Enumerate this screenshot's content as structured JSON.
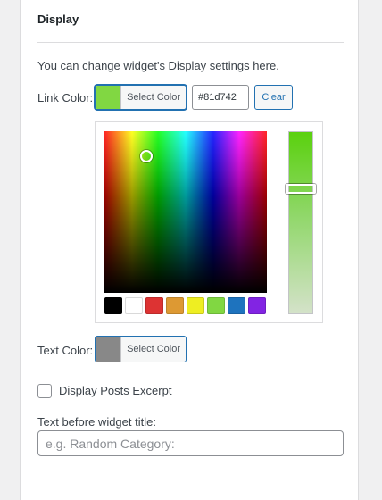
{
  "section": {
    "heading": "Display",
    "description": "You can change widget's Display settings here."
  },
  "link_color": {
    "label": "Link Color:",
    "swatch": "#81d742",
    "button_label": "Select Color",
    "hex_value": "#81d742",
    "clear_label": "Clear"
  },
  "picker": {
    "palettes": [
      "#000000",
      "#ffffff",
      "#dd3333",
      "#dd9933",
      "#eeee22",
      "#81d742",
      "#1e73be",
      "#8224e3"
    ]
  },
  "text_color": {
    "label": "Text Color:",
    "swatch": "#888888",
    "button_label": "Select Color"
  },
  "excerpt": {
    "label": "Display Posts Excerpt",
    "checked": false
  },
  "before_title": {
    "label": "Text before widget title:",
    "placeholder": "e.g. Random Category:",
    "value": ""
  }
}
